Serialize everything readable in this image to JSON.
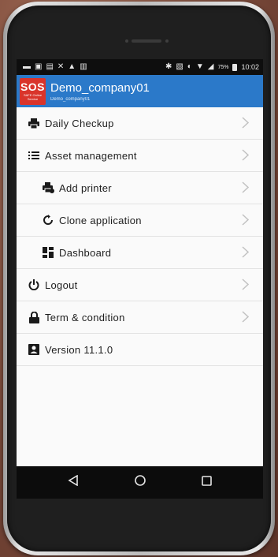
{
  "status_bar": {
    "left_icons": [
      "message-icon",
      "image-icon",
      "mail-icon",
      "missed-call-icon",
      "warning-icon",
      "notes-icon"
    ],
    "right_icons": [
      "bluetooth-icon",
      "nfc-icon",
      "data-saver-icon",
      "wifi-icon",
      "signal-icon"
    ],
    "battery": "75%",
    "time": "10:02"
  },
  "header": {
    "logo_text": "SOS",
    "logo_subtext": "SAFE Online Service",
    "company_name": "Demo_company01",
    "company_sub": "Demo_company01",
    "bg_color": "#2b79c9",
    "logo_color": "#d9342b"
  },
  "menu": {
    "items": [
      {
        "label": "Daily Checkup",
        "icon": "printer-icon",
        "chevron": true,
        "indent": 0
      },
      {
        "label": "Asset management",
        "icon": "list-icon",
        "chevron": true,
        "indent": 0
      },
      {
        "label": "Add printer",
        "icon": "add-printer-icon",
        "chevron": true,
        "indent": 1
      },
      {
        "label": "Clone application",
        "icon": "sync-icon",
        "chevron": true,
        "indent": 1
      },
      {
        "label": "Dashboard",
        "icon": "dashboard-icon",
        "chevron": true,
        "indent": 1
      },
      {
        "label": "Logout",
        "icon": "power-icon",
        "chevron": true,
        "indent": 0
      },
      {
        "label": "Term & condition",
        "icon": "lock-icon",
        "chevron": true,
        "indent": 0
      },
      {
        "label": "Version 11.1.0",
        "icon": "account-box-icon",
        "chevron": false,
        "indent": 0
      }
    ]
  },
  "nav_bar": {
    "buttons": [
      "back-icon",
      "home-icon",
      "recents-icon"
    ]
  }
}
